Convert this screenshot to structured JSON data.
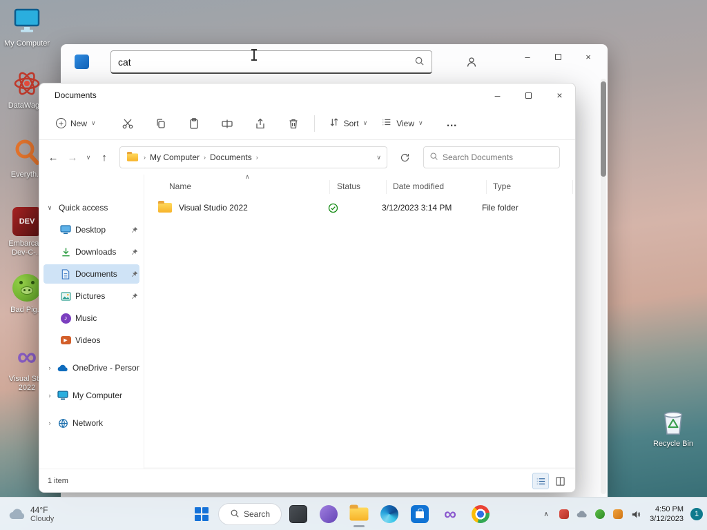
{
  "glyphs": {
    "back": "←",
    "forward": "→",
    "up": "↑",
    "chevron_down": "∨",
    "chevron_up": "∧",
    "chevron_right": "›",
    "crumb_sep": "›",
    "minimize": "–",
    "close": "×",
    "more": "…",
    "plus": "+",
    "infinity": "∞",
    "note": "♪",
    "play": "▶",
    "sort_caret": "∧"
  },
  "desktop": {
    "icons": [
      {
        "label": "My Computer"
      },
      {
        "label": "DataWag..."
      },
      {
        "label": "Everyth..."
      },
      {
        "label": "Embarca...",
        "label2": "Dev-C-..."
      },
      {
        "label": "Bad Pig..."
      },
      {
        "label": "Visual St...",
        "label2": "2022"
      }
    ],
    "recycle_bin_label": "Recycle Bin"
  },
  "bg_window": {
    "search_value": "cat"
  },
  "explorer": {
    "title": "Documents",
    "toolbar": {
      "new_label": "New",
      "sort_label": "Sort",
      "view_label": "View"
    },
    "nav": {
      "crumb1": "My Computer",
      "crumb2": "Documents",
      "search_placeholder": "Search Documents"
    },
    "sidebar": {
      "items": [
        {
          "label": "Quick access"
        },
        {
          "label": "Desktop"
        },
        {
          "label": "Downloads"
        },
        {
          "label": "Documents"
        },
        {
          "label": "Pictures"
        },
        {
          "label": "Music"
        },
        {
          "label": "Videos"
        },
        {
          "label": "OneDrive - Personal"
        },
        {
          "label": "My Computer"
        },
        {
          "label": "Network"
        }
      ]
    },
    "columns": {
      "name": "Name",
      "status": "Status",
      "date": "Date modified",
      "type": "Type"
    },
    "files": [
      {
        "name": "Visual Studio 2022",
        "date": "3/12/2023 3:14 PM",
        "type": "File folder"
      }
    ],
    "statusbar": {
      "count": "1 item"
    }
  },
  "taskbar": {
    "weather": {
      "temp": "44°F",
      "condition": "Cloudy"
    },
    "search_label": "Search",
    "clock": {
      "time": "4:50 PM",
      "date": "3/12/2023"
    },
    "notification_count": "1"
  }
}
